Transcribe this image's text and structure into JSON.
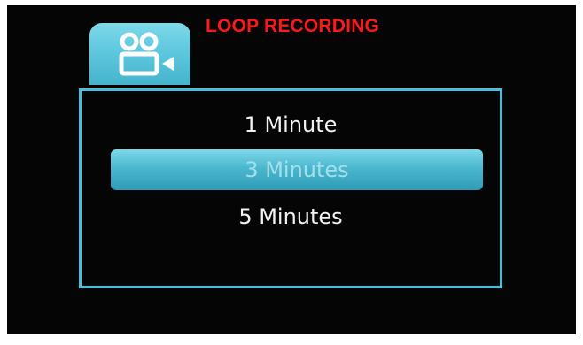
{
  "header": {
    "title": "LOOP RECORDING",
    "icon": "video-camera-icon"
  },
  "menu": {
    "options": [
      "1 Minute",
      "3 Minutes",
      "5 Minutes"
    ],
    "selected_index": 1
  },
  "colors": {
    "title": "#ff1a1a",
    "accent": "#48c0d6",
    "background": "#050505",
    "option_text": "#f2f2f2"
  }
}
